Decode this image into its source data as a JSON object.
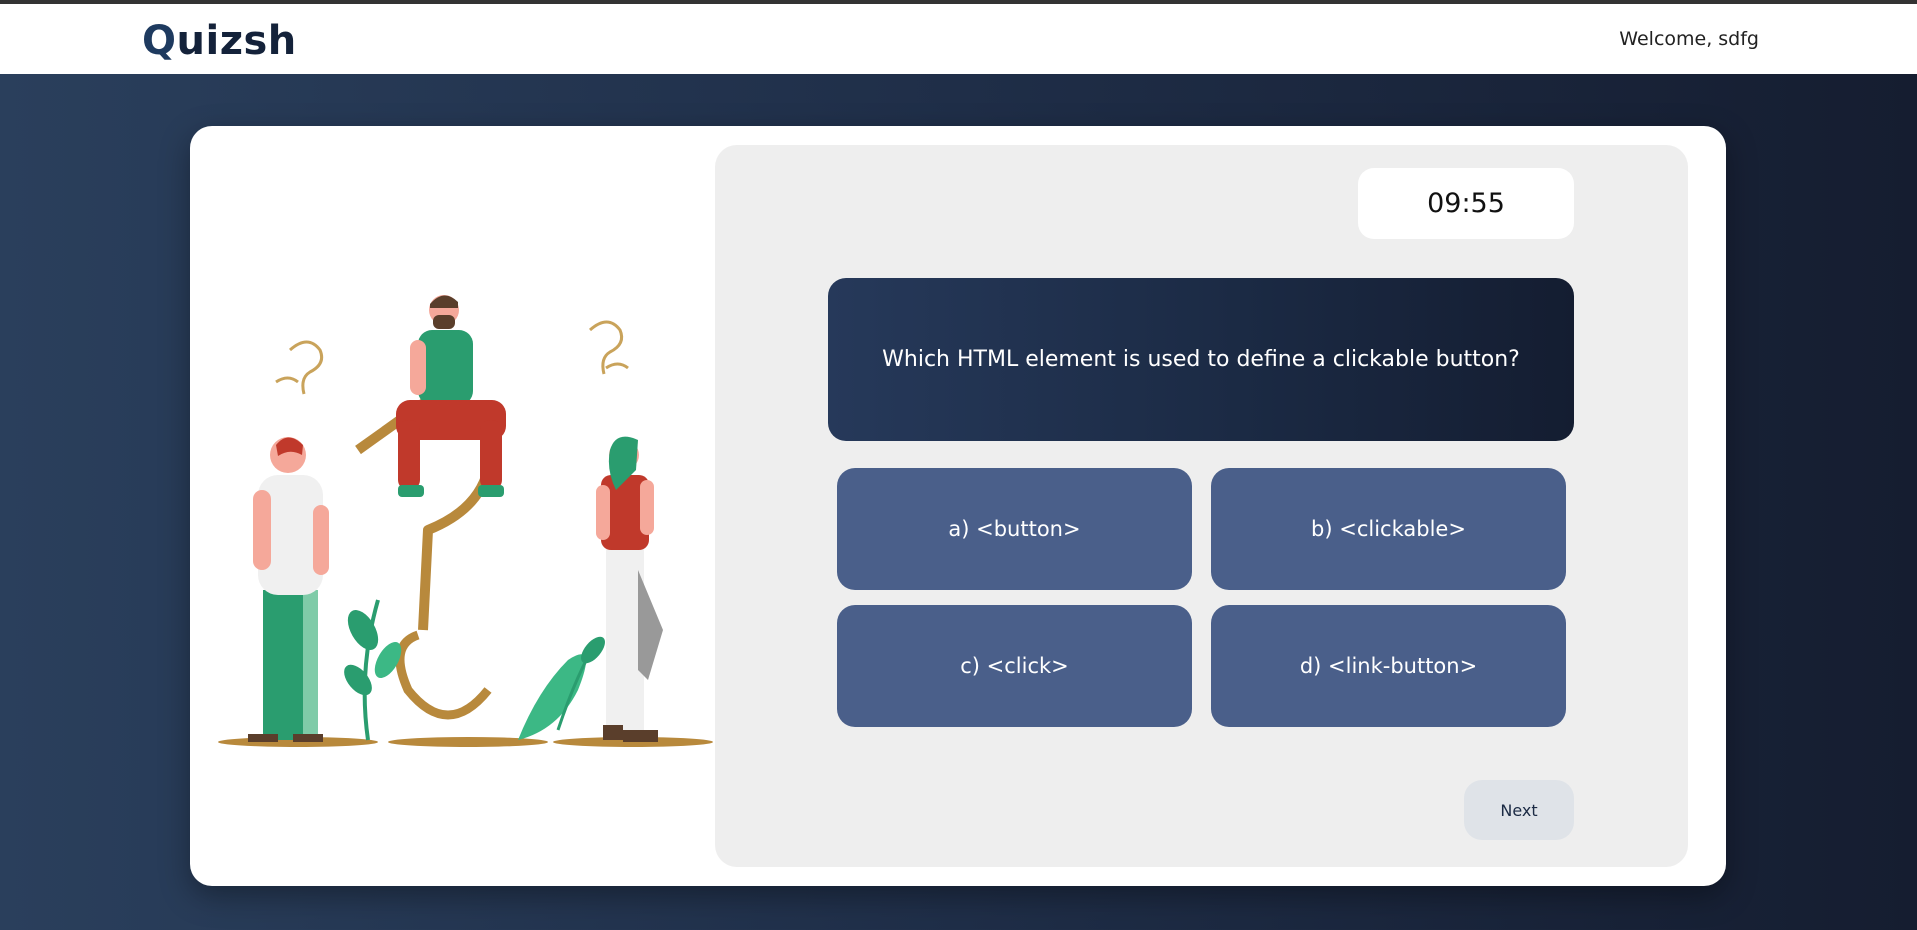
{
  "app": {
    "logo_first_letter": "Q",
    "logo_rest": "uizsh",
    "welcome_text": "Welcome, sdfg"
  },
  "quiz": {
    "timer": "09:55",
    "question": "Which HTML element is used to define a clickable button?",
    "options": [
      {
        "label": "a) <button>"
      },
      {
        "label": "b) <clickable>"
      },
      {
        "label": "c) <click>"
      },
      {
        "label": "d) <link-button>"
      }
    ],
    "next_label": "Next"
  },
  "illustration": {
    "description_icon": "people-thinking-question-mark-illustration"
  },
  "colors": {
    "background_start": "#2a3f5c",
    "background_end": "#151d30",
    "option_bg": "#4a5f8a",
    "question_bg": "#1b2a44",
    "panel_bg": "#eeeeee",
    "accent_green": "#2a9d6f",
    "accent_red": "#c0392b",
    "accent_gold": "#b8893c"
  }
}
